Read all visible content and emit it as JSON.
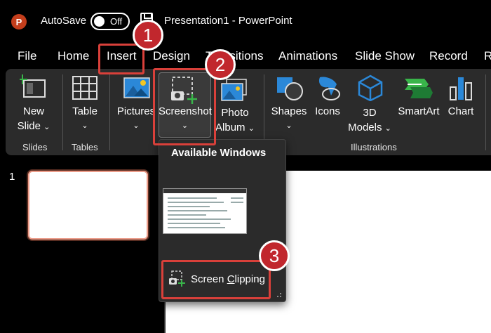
{
  "titlebar": {
    "app_logo": "P",
    "autosave_label": "AutoSave",
    "autosave_state": "Off",
    "title": "Presentation1  -  PowerPoint"
  },
  "tabs": [
    "File",
    "Home",
    "Insert",
    "Design",
    "Transitions",
    "Animations",
    "Slide Show",
    "Record",
    "R"
  ],
  "active_tab": "Insert",
  "ribbon": {
    "new_slide": [
      "New",
      "Slide"
    ],
    "table": "Table",
    "pictures": "Pictures",
    "screenshot": "Screenshot",
    "photo_album": [
      "Photo",
      "Album"
    ],
    "shapes": "Shapes",
    "icons": "Icons",
    "models": [
      "3D",
      "Models"
    ],
    "smartart": "SmartArt",
    "chart": "Chart",
    "groups": {
      "slides": "Slides",
      "tables": "Tables",
      "illustrations": "Illustrations"
    }
  },
  "dropdown": {
    "title": "Available Windows",
    "screen_clipping": "Screen Clipping",
    "access_key": "C"
  },
  "slides": {
    "number": "1"
  },
  "annotations": {
    "badge1": "1",
    "badge2": "2",
    "badge3": "3",
    "color": "#d9403a"
  },
  "colors": {
    "accent": "#c43e1c",
    "ribbon_bg": "#2b2b2b",
    "green": "#39b54a",
    "blue": "#2b88d8"
  }
}
